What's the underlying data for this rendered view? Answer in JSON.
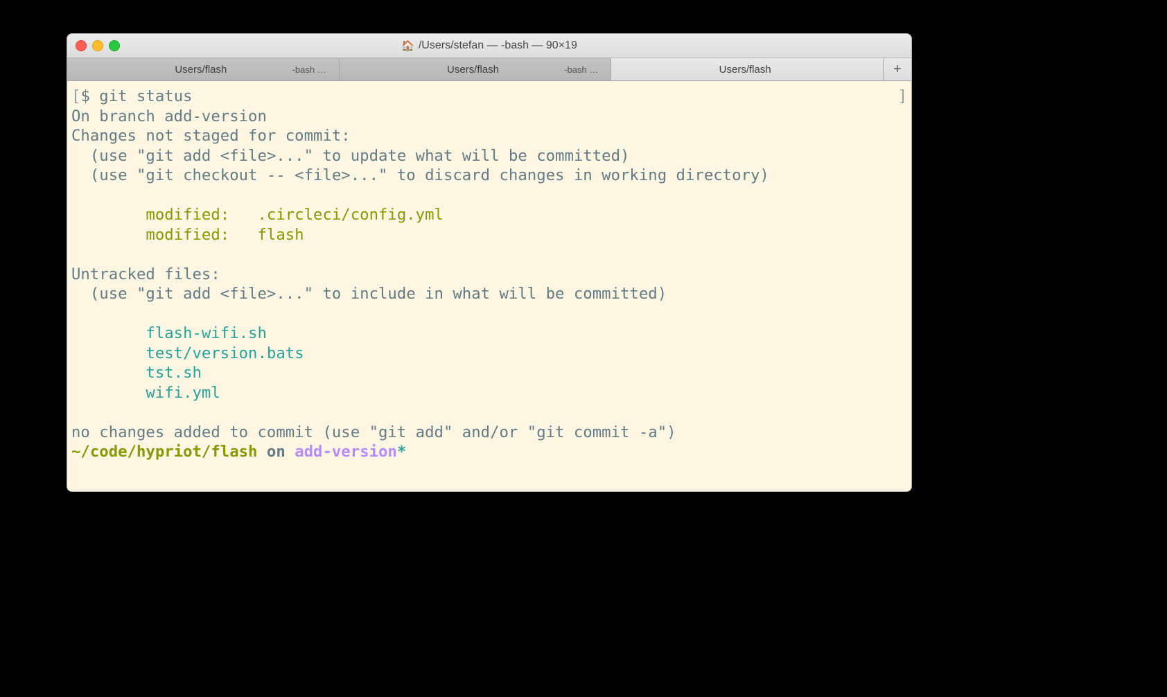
{
  "window": {
    "title": "/Users/stefan — -bash — 90×19"
  },
  "tabs": [
    {
      "label": "Users/flash",
      "sub": "-bash …",
      "active": false
    },
    {
      "label": "Users/flash",
      "sub": "-bash …",
      "active": false
    },
    {
      "label": "Users/flash",
      "sub": "",
      "active": true
    }
  ],
  "terminal": {
    "prompt_open": "[",
    "prompt_close": "]",
    "prompt_symbol": "$ ",
    "command": "git status",
    "branch_line": "On branch add-version",
    "changes_header": "Changes not staged for commit:",
    "hint_add": "  (use \"git add <file>...\" to update what will be committed)",
    "hint_checkout": "  (use \"git checkout -- <file>...\" to discard changes in working directory)",
    "modified": [
      "        modified:   .circleci/config.yml",
      "        modified:   flash"
    ],
    "untracked_header": "Untracked files:",
    "hint_untracked": "  (use \"git add <file>...\" to include in what will be committed)",
    "untracked": [
      "        flash-wifi.sh",
      "        test/version.bats",
      "        tst.sh",
      "        wifi.yml"
    ],
    "footer": "no changes added to commit (use \"git add\" and/or \"git commit -a\")",
    "ps1_path": "~/code/hypriot/flash",
    "ps1_on": " on ",
    "ps1_branch": "add-version",
    "ps1_dirty": "*"
  }
}
